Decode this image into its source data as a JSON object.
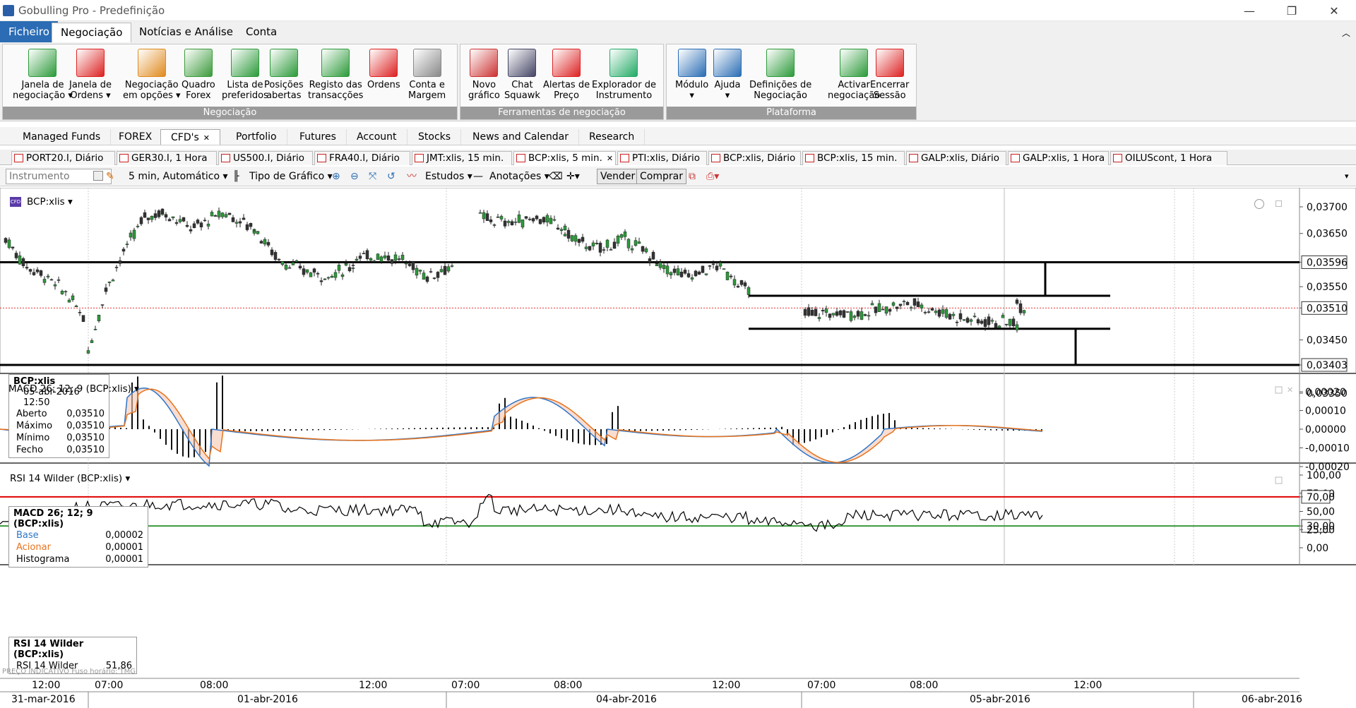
{
  "window": {
    "title": "Gobulling Pro - Predefinição",
    "minimize": "—",
    "restore": "❐",
    "close": "✕"
  },
  "ribbon_tabs": [
    "Ficheiro",
    "Negociação",
    "Notícias e Análise",
    "Conta"
  ],
  "ribbon": {
    "group_negociacao": {
      "label": "Negociação",
      "buttons": [
        {
          "label1": "Janela de",
          "label2": "negociação ▾",
          "icon": "trade-window-icon",
          "color": "#2c9a3a"
        },
        {
          "label1": "Janela de",
          "label2": "Ordens ▾",
          "icon": "orders-window-icon",
          "color": "#d22"
        },
        {
          "label1": "Negociação",
          "label2": "em opções ▾",
          "icon": "options-trading-icon",
          "color": "#e08a1e"
        },
        {
          "label1": "Quadro",
          "label2": "Forex",
          "icon": "forex-board-icon",
          "color": "#3b9a3b"
        },
        {
          "label1": "Lista de",
          "label2": "preferidos",
          "icon": "watchlist-icon",
          "color": "#2c9a3a"
        },
        {
          "label1": "Posições",
          "label2": "abertas",
          "icon": "open-positions-icon",
          "color": "#2c9a3a"
        },
        {
          "label1": "Registo das",
          "label2": "transacções",
          "icon": "transactions-icon",
          "color": "#2c9a3a"
        },
        {
          "label1": "Ordens",
          "label2": "",
          "icon": "orders-icon",
          "color": "#d22"
        },
        {
          "label1": "Conta e",
          "label2": "Margem",
          "icon": "account-margin-icon",
          "color": "#888"
        }
      ]
    },
    "group_ferramentas": {
      "label": "Ferramentas de negociação",
      "buttons": [
        {
          "label1": "Novo",
          "label2": "gráfico",
          "icon": "new-chart-icon",
          "color": "#c33"
        },
        {
          "label1": "Chat",
          "label2": "Squawk",
          "icon": "chat-squawk-icon",
          "color": "#446"
        },
        {
          "label1": "Alertas de",
          "label2": "Preço",
          "icon": "price-alert-icon",
          "color": "#d22"
        },
        {
          "label1": "Explorador de",
          "label2": "Instrumento",
          "icon": "instrument-explorer-icon",
          "color": "#2a6"
        }
      ]
    },
    "group_plataforma": {
      "label": "Plataforma",
      "buttons": [
        {
          "label1": "Módulo",
          "label2": "▾",
          "icon": "module-icon",
          "color": "#2a6db4"
        },
        {
          "label1": "Ajuda",
          "label2": "▾",
          "icon": "help-icon",
          "color": "#2a6db4"
        },
        {
          "label1": "Definições de",
          "label2": "Negociação",
          "icon": "trading-settings-icon",
          "color": "#2c9a3a"
        },
        {
          "label1": "Activar",
          "label2": "negociação",
          "icon": "activate-trading-icon",
          "color": "#2c9a3a"
        },
        {
          "label1": "Encerrar",
          "label2": "Sessão",
          "icon": "logout-icon",
          "color": "#d22"
        }
      ]
    }
  },
  "categories": [
    "Managed Funds",
    "FOREX",
    "CFD's",
    "Portfolio",
    "Futures",
    "Account",
    "Stocks",
    "News and Calendar",
    "Research"
  ],
  "categories_close": "✕",
  "chart_tabs": [
    "PORT20.I, Diário",
    "GER30.I, 1 Hora",
    "US500.I, Diário",
    "FRA40.I, Diário",
    "JMT:xlis, 15 min.",
    "BCP:xlis, 5 min.",
    "PTI:xlis, Diário",
    "BCP:xlis, Diário",
    "BCP:xlis, 15 min.",
    "GALP:xlis, Diário",
    "GALP:xlis, 1 Hora",
    "OILUScont, 1 Hora"
  ],
  "chart_tab_close": "✕",
  "toolbar": {
    "instrument_placeholder": "Instrumento",
    "interval": "5 min,  Automático ▾",
    "chart_type": "Tipo de Gráfico ▾",
    "studies": "Estudos ▾",
    "annotations": "Anotações ▾",
    "sell": "Vender",
    "buy": "Comprar"
  },
  "price_panel": {
    "symbol": "BCP:xlis ▾",
    "badge": "CFD",
    "y_labels": [
      "0,03700",
      "0,03650",
      "0,03596",
      "0,03550",
      "0,03510",
      "0,03450",
      "0,03403",
      "0,03350"
    ],
    "info": {
      "title": "BCP:xlis",
      "datetime": "05-abr-2016 12:50",
      "rows": [
        [
          "Aberto",
          "0,03510"
        ],
        [
          "Máximo",
          "0,03510"
        ],
        [
          "Mínimo",
          "0,03510"
        ],
        [
          "Fecho",
          "0,03510"
        ]
      ]
    }
  },
  "macd_panel": {
    "title": "MACD 26; 12; 9 (BCP:xlis) ▾",
    "y_labels": [
      "0,00020",
      "0,00010",
      "0,00000",
      "-0,00010",
      "-0,00020"
    ],
    "info": {
      "title": "MACD 26; 12; 9 (BCP:xlis)",
      "rows": [
        [
          "Base",
          "0,00002"
        ],
        [
          "Acionar",
          "0,00001"
        ],
        [
          "Histograma",
          "0,00001"
        ]
      ]
    },
    "base_color": "#2e75c8",
    "trigger_color": "#e8731c"
  },
  "rsi_panel": {
    "title": "RSI 14 Wilder (BCP:xlis) ▾",
    "y_labels": [
      "100,00",
      "75,00",
      "70,00",
      "50,00",
      "30,00",
      "25,00",
      "0,00"
    ],
    "info": {
      "title": "RSI 14 Wilder (BCP:xlis)",
      "rows": [
        [
          "RSI 14 Wilder",
          "51,86"
        ]
      ]
    },
    "upper_color": "#e00000",
    "lower_color": "#3a9a3a"
  },
  "footer_note": "PREÇO INDICATIVO   Fuso horário: TMG",
  "time_axis": {
    "times": [
      "12:00",
      "07:00",
      "08:00",
      "12:00",
      "07:00",
      "08:00",
      "12:00",
      "07:00",
      "08:00",
      "12:00"
    ],
    "dates": [
      "31-mar-2016",
      "01-abr-2016",
      "04-abr-2016",
      "05-abr-2016",
      "06-abr-2016"
    ]
  },
  "colors": {
    "accent": "#2b6cb4",
    "bull": "#2c9a3a",
    "bear": "#d22"
  }
}
